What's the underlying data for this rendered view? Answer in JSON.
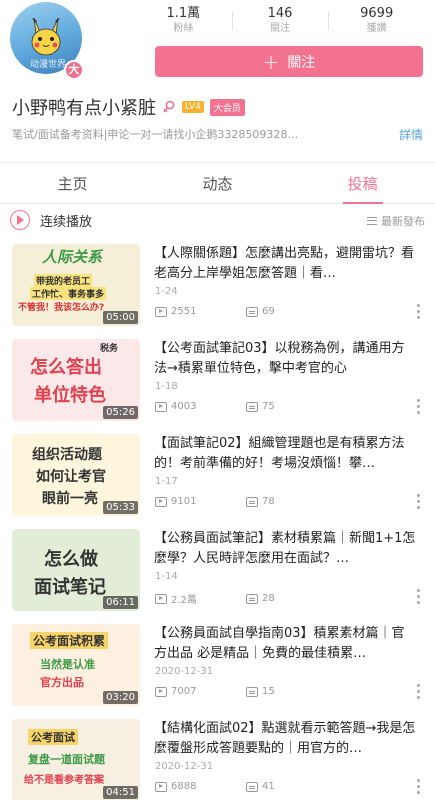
{
  "profile": {
    "avatar_badge": "大",
    "name": "小野鸭有点小紧脏",
    "level": "LV4",
    "vip": "大会员",
    "signature": "笔试/面试备考资料|申论一对一请找小企鹅3328509328…",
    "detail_link": "詳情"
  },
  "stats": [
    {
      "num": "1.1萬",
      "label": "粉絲"
    },
    {
      "num": "146",
      "label": "關注"
    },
    {
      "num": "9699",
      "label": "獲讚"
    }
  ],
  "follow": {
    "icon": "plus-icon",
    "label": "關注"
  },
  "tabs": [
    {
      "label": "主页",
      "active": false
    },
    {
      "label": "动态",
      "active": false
    },
    {
      "label": "投稿",
      "active": true
    }
  ],
  "playlist": {
    "label": "连续播放",
    "sort": "最新發布"
  },
  "videos": [
    {
      "title": "【人際關係題】怎麼講出亮點，避開雷坑？看老高分上岸學姐怎麼答題｜看…",
      "date": "1-24",
      "views": "2551",
      "danmaku": "69",
      "duration": "05:00",
      "thumb_lines": [
        "人际关系",
        "带我的老员工",
        "工作忙、事务事多",
        "不管我！我该怎么办?"
      ]
    },
    {
      "title": "【公考面試筆記03】以稅務為例，講通用方法→積累單位特色，擊中考官的心",
      "date": "1-18",
      "views": "4003",
      "danmaku": "75",
      "duration": "05:26",
      "thumb_lines": [
        "税务",
        "怎么答出",
        "单位特色"
      ]
    },
    {
      "title": "【面試筆記02】組織管理題也是有積累方法的！考前準備的好！考場沒煩惱！攀…",
      "date": "1-17",
      "views": "9101",
      "danmaku": "78",
      "duration": "05:33",
      "thumb_lines": [
        "组织活动题",
        "如何让考官",
        "眼前一亮"
      ]
    },
    {
      "title": "【公務員面試筆記】素材積累篇｜新聞1+1怎麼學？人民時評怎麼用在面試？…",
      "date": "1-14",
      "views": "2.2萬",
      "danmaku": "28",
      "duration": "06:11",
      "thumb_lines": [
        "怎么做",
        "面试笔记"
      ]
    },
    {
      "title": "【公務員面試自學指南03】積累素材篇｜官方出品 必是精品｜免費的最佳積累…",
      "date": "2020-12-31",
      "views": "7007",
      "danmaku": "15",
      "duration": "03:20",
      "thumb_lines": [
        "公考面试积累",
        "当然是认准",
        "官方出品"
      ]
    },
    {
      "title": "【結構化面試02】點選就看示範答題→我是怎麼覆盤形成答題要點的｜用官方的…",
      "date": "2020-12-31",
      "views": "6888",
      "danmaku": "41",
      "duration": "04:51",
      "thumb_lines": [
        "公考面试",
        "复盘一道面试题",
        "给不是看参考答案"
      ]
    }
  ]
}
